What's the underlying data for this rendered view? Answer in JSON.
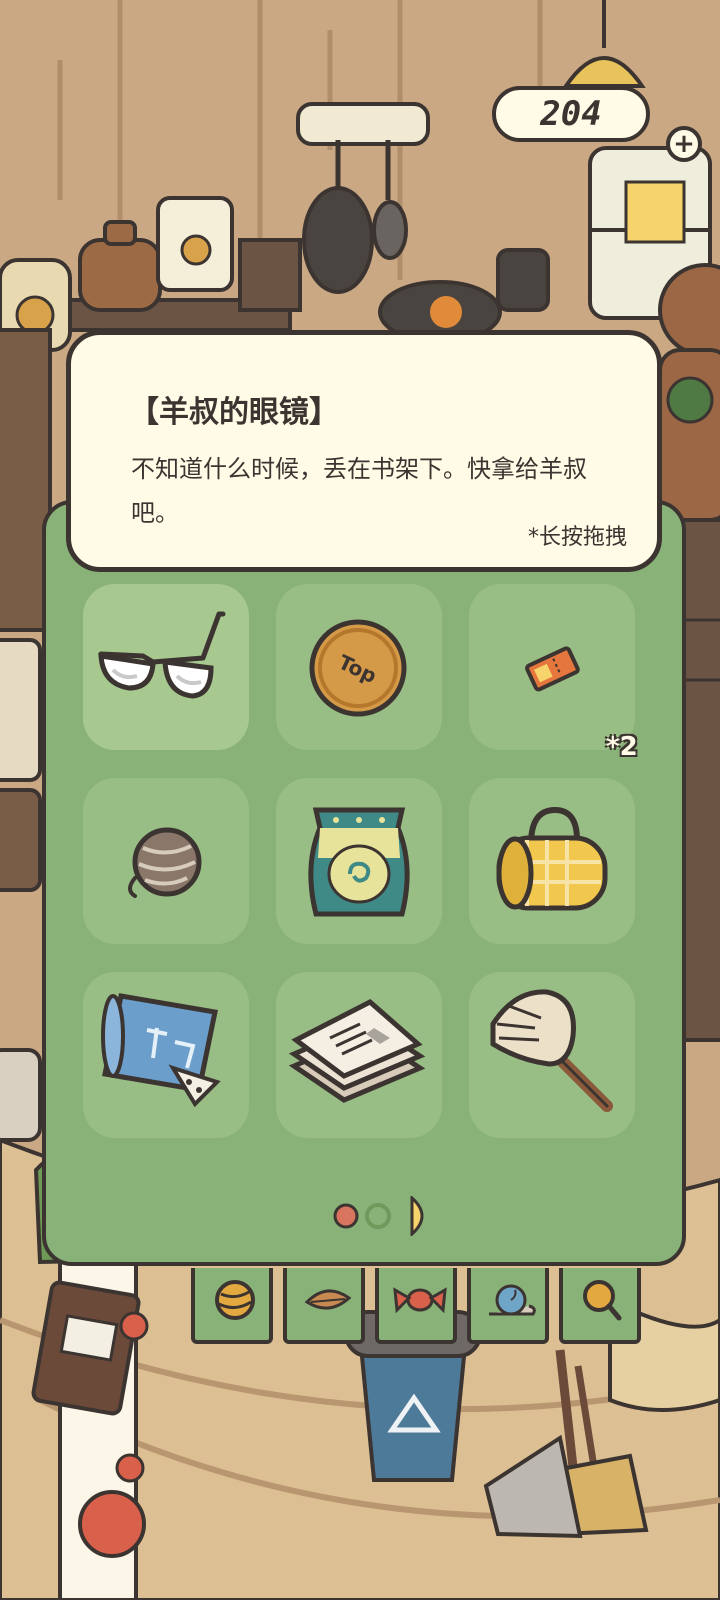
{
  "hud": {
    "currency_value": "204",
    "add_label": "+"
  },
  "item_detail": {
    "title": "【羊叔的眼镜】",
    "description": "不知道什么时候，丢在书架下。快拿给羊叔吧。",
    "hint": "*长按拖拽"
  },
  "inventory": {
    "items": [
      {
        "icon": "glasses-icon",
        "selected": true
      },
      {
        "icon": "coin-icon",
        "coin_label": "Top"
      },
      {
        "icon": "ticket-icon",
        "quantity_label": "*2"
      },
      {
        "icon": "yarn-ball-icon"
      },
      {
        "icon": "snack-bag-icon"
      },
      {
        "icon": "picnic-mat-icon"
      },
      {
        "icon": "blueprint-icon"
      },
      {
        "icon": "newspaper-icon"
      },
      {
        "icon": "duster-icon"
      }
    ],
    "pagination": {
      "total_pages": 3,
      "current_page": 1
    }
  },
  "category_tabs": [
    {
      "icon": "yarn-ball-icon"
    },
    {
      "icon": "leaf-icon"
    },
    {
      "icon": "candy-icon"
    },
    {
      "icon": "snail-icon"
    },
    {
      "icon": "magnifier-icon"
    }
  ],
  "colors": {
    "panel": "#89b278",
    "slot": "#98bd85",
    "slot_selected": "#a7c98f",
    "card": "#fffbe6",
    "outline": "#3c3431",
    "page_dot_active": "#d9745e"
  }
}
